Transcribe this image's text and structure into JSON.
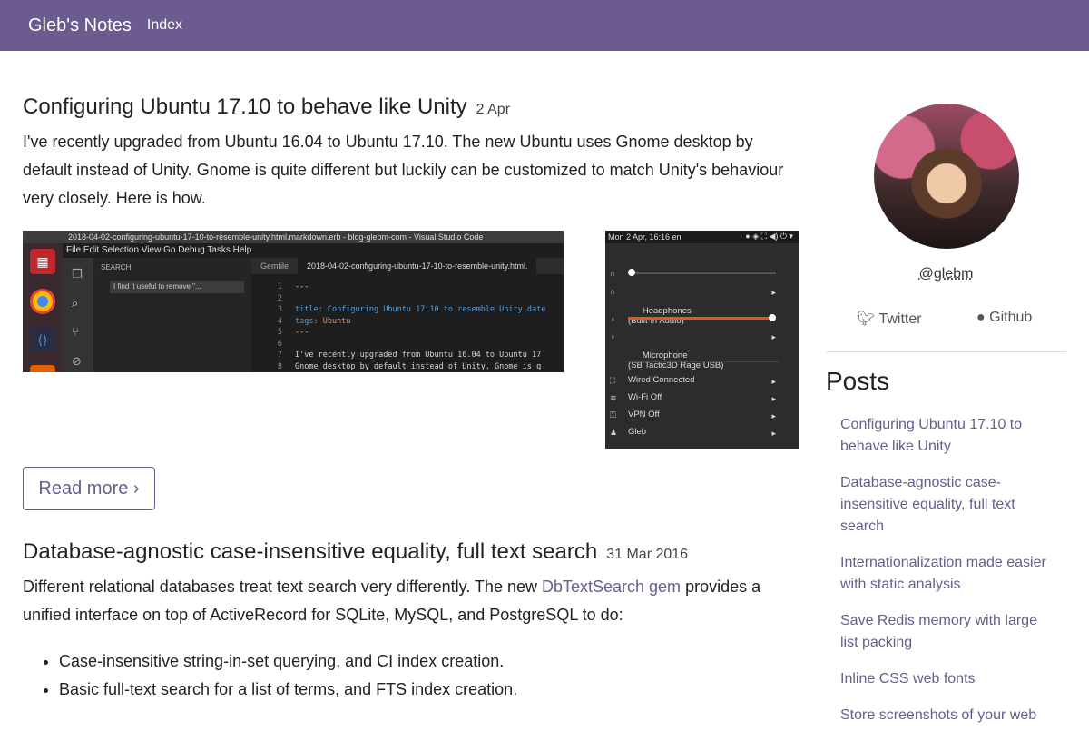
{
  "nav": {
    "brand": "Gleb's Notes",
    "index": "Index"
  },
  "post1": {
    "title": "Configuring Ubuntu 17.10 to behave like Unity",
    "date": "2 Apr",
    "excerpt": "I've recently upgraded from Ubuntu 16.04 to Ubuntu 17.10. The new Ubuntu uses Gnome desktop by default instead of Unity. Gnome is quite different but luckily can be customized to match Unity's behaviour very closely. Here is how.",
    "read_more": "Read more ›"
  },
  "vscode_shot": {
    "title": "2018-04-02-configuring-ubuntu-17-10-to-resemble-unity.html.markdown.erb - blog-glebm-com - Visual Studio Code",
    "menu": "File  Edit  Selection  View  Go  Debug  Tasks  Help",
    "search_label": "SEARCH",
    "search_value": "I find it useful to remove \"...",
    "tab1": "Gemfile",
    "tab2": "2018-04-02-configuring-ubuntu-17-10-to-resemble-unity.html.",
    "gutter": "1\n2\n3\n4\n5\n6\n7\n8",
    "line1": "---",
    "line3_key": "title:",
    "line3_val": " Configuring Ubuntu 17.10 to resemble Unity date",
    "line4_key": "tags:",
    "line4_val": " Ubuntu",
    "line5": "---",
    "line7": "I've recently upgraded from Ubuntu 16.04 to Ubuntu 17",
    "line8": "Gnome desktop by default instead of Unity. Gnome is q"
  },
  "ubuntu_shot": {
    "topbar": "Mon  2 Apr, 16:16    en",
    "headphones": "Headphones\n(Built-in Audio)",
    "microphone": "Microphone\n(SB Tactic3D Rage USB)",
    "wired": "Wired Connected",
    "wifi": "Wi-Fi Off",
    "vpn": "VPN Off",
    "user": "Gleb",
    "output_volume": 0.0,
    "input_volume": 1.0
  },
  "post2": {
    "title": "Database-agnostic case-insensitive equality, full text search",
    "date": "31 Mar 2016",
    "text_before": "Different relational databases treat text search very differently. The new ",
    "link": "DbTextSearch gem",
    "text_after": " provides a unified interface on top of ActiveRecord for SQLite, MySQL, and PostgreSQL to do:",
    "bullets": [
      "Case-insensitive string-in-set querying, and CI index creation.",
      "Basic full-text search for a list of terms, and FTS index creation."
    ]
  },
  "sidebar": {
    "handle": "@glebm",
    "twitter": "Twitter",
    "github": "Github",
    "posts_heading": "Posts",
    "posts": [
      "Configuring Ubuntu 17.10 to behave like Unity",
      "Database-agnostic case-insensitive equality, full text search",
      "Internationalization made easier with static analysis",
      "Save Redis memory with large list packing",
      "Inline CSS web fonts",
      "Store screenshots of your web"
    ]
  },
  "colors": {
    "accent": "#6b5b8e",
    "topbar": "#6b5b8e"
  }
}
